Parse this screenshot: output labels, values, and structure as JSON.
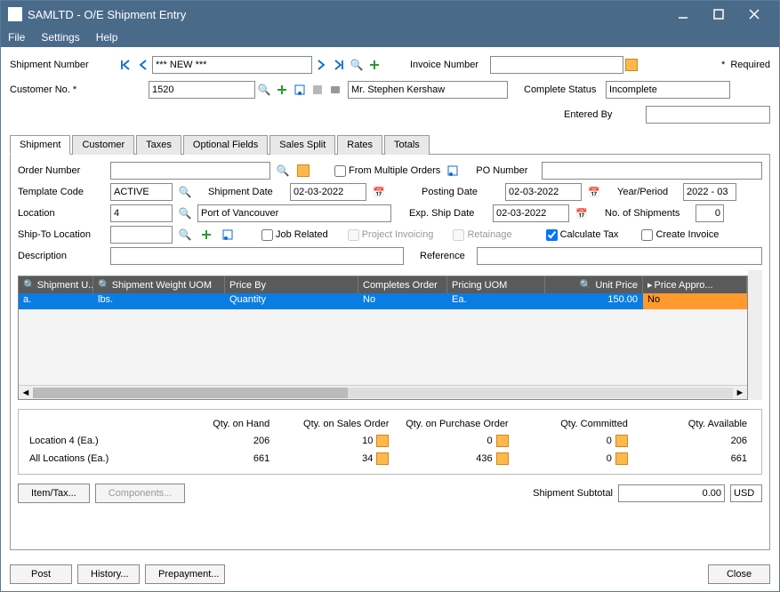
{
  "titlebar": {
    "title": "SAMLTD - O/E Shipment Entry"
  },
  "menu": {
    "file": "File",
    "settings": "Settings",
    "help": "Help"
  },
  "header": {
    "shipment_no_lbl": "Shipment Number",
    "shipment_no_val": "*** NEW ***",
    "invoice_no_lbl": "Invoice Number",
    "invoice_no_val": "",
    "required_lbl": "Required",
    "customer_no_lbl": "Customer No. *",
    "customer_no_val": "1520",
    "customer_name": "Mr. Stephen Kershaw",
    "complete_status_lbl": "Complete Status",
    "complete_status_val": "Incomplete",
    "entered_by_lbl": "Entered By",
    "entered_by_val": ""
  },
  "tabs": {
    "shipment": "Shipment",
    "customer": "Customer",
    "taxes": "Taxes",
    "optional": "Optional Fields",
    "sales_split": "Sales Split",
    "rates": "Rates",
    "totals": "Totals"
  },
  "form": {
    "order_no_lbl": "Order Number",
    "order_no_val": "",
    "from_multi_lbl": "From Multiple Orders",
    "po_no_lbl": "PO Number",
    "po_no_val": "",
    "template_lbl": "Template Code",
    "template_val": "ACTIVE",
    "ship_date_lbl": "Shipment Date",
    "ship_date_val": "02-03-2022",
    "post_date_lbl": "Posting Date",
    "post_date_val": "02-03-2022",
    "year_period_lbl": "Year/Period",
    "year_period_val": "2022 - 03",
    "location_lbl": "Location",
    "location_val": "4",
    "location_name": "Port of Vancouver",
    "exp_ship_lbl": "Exp. Ship Date",
    "exp_ship_val": "02-03-2022",
    "no_ship_lbl": "No. of Shipments",
    "no_ship_val": "0",
    "shipto_lbl": "Ship-To Location",
    "shipto_val": "",
    "job_related_lbl": "Job Related",
    "project_inv_lbl": "Project Invoicing",
    "retainage_lbl": "Retainage",
    "calc_tax_lbl": "Calculate Tax",
    "create_inv_lbl": "Create Invoice",
    "description_lbl": "Description",
    "description_val": "",
    "reference_lbl": "Reference",
    "reference_val": ""
  },
  "grid": {
    "headers": [
      "Shipment U...",
      "Shipment Weight UOM",
      "Price By",
      "Completes Order",
      "Pricing UOM",
      "Unit Price",
      "Price Appro..."
    ],
    "row": {
      "c0": "a.",
      "c1": "lbs.",
      "c2": "Quantity",
      "c3": "No",
      "c4": "Ea.",
      "c5": "150.00",
      "c6": "No"
    }
  },
  "qty": {
    "h1": "Qty. on Hand",
    "h2": "Qty. on Sales Order",
    "h3": "Qty. on Purchase Order",
    "h4": "Qty. Committed",
    "h5": "Qty. Available",
    "loc_lbl": "Location    4 (Ea.)",
    "loc": {
      "v1": "206",
      "v2": "10",
      "v3": "0",
      "v4": "0",
      "v5": "206"
    },
    "all_lbl": "All Locations (Ea.)",
    "all": {
      "v1": "661",
      "v2": "34",
      "v3": "436",
      "v4": "0",
      "v5": "661"
    }
  },
  "buttons": {
    "item_tax": "Item/Tax...",
    "components": "Components...",
    "subtotal_lbl": "Shipment Subtotal",
    "subtotal_val": "0.00",
    "currency": "USD",
    "post": "Post",
    "history": "History...",
    "prepayment": "Prepayment...",
    "close": "Close"
  }
}
